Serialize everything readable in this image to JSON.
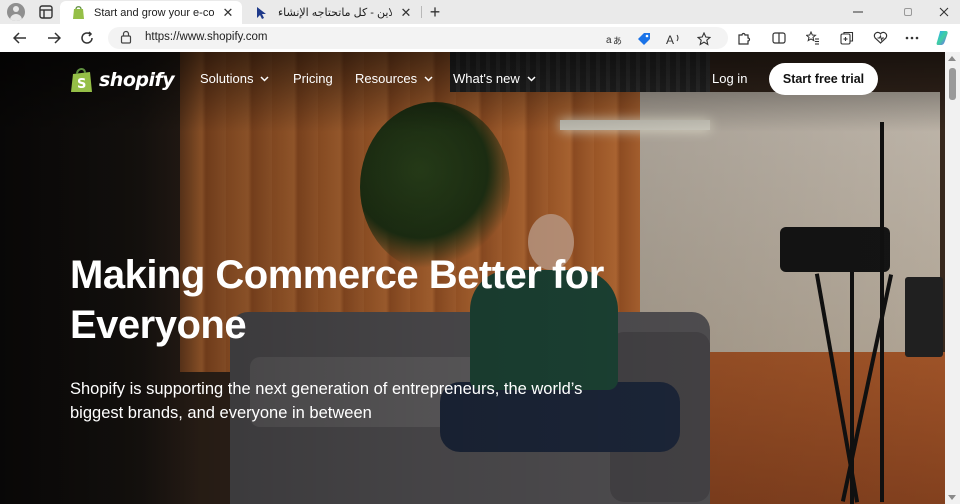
{
  "browser": {
    "tabs": [
      {
        "title": "Start and grow your e-commerce",
        "favicon": "shopify-bag-icon",
        "active": true
      },
      {
        "title": "انطلق أونلاين - كل ماتحتاجه الإنشاء",
        "favicon": "arrow-cursor-icon",
        "active": false
      }
    ],
    "address": {
      "url": "https://www.shopify.com"
    },
    "colors": {
      "tabbar": "#eaeaea",
      "toolbar": "#ffffff",
      "urlbox": "#f3f3f3"
    }
  },
  "site": {
    "brand": "shopify",
    "nav": [
      {
        "label": "Solutions",
        "has_dropdown": true
      },
      {
        "label": "Pricing",
        "has_dropdown": false
      },
      {
        "label": "Resources",
        "has_dropdown": true
      },
      {
        "label": "What's new",
        "has_dropdown": true
      }
    ],
    "login_label": "Log in",
    "cta_label": "Start free trial",
    "hero": {
      "title": "Making Commerce Better for Everyone",
      "subtitle": "Shopify is supporting the next generation of entrepreneurs, the world’s biggest brands, and everyone in between"
    },
    "colors": {
      "brand_green": "#95bf47",
      "cta_bg": "#ffffff",
      "text": "#ffffff"
    }
  }
}
